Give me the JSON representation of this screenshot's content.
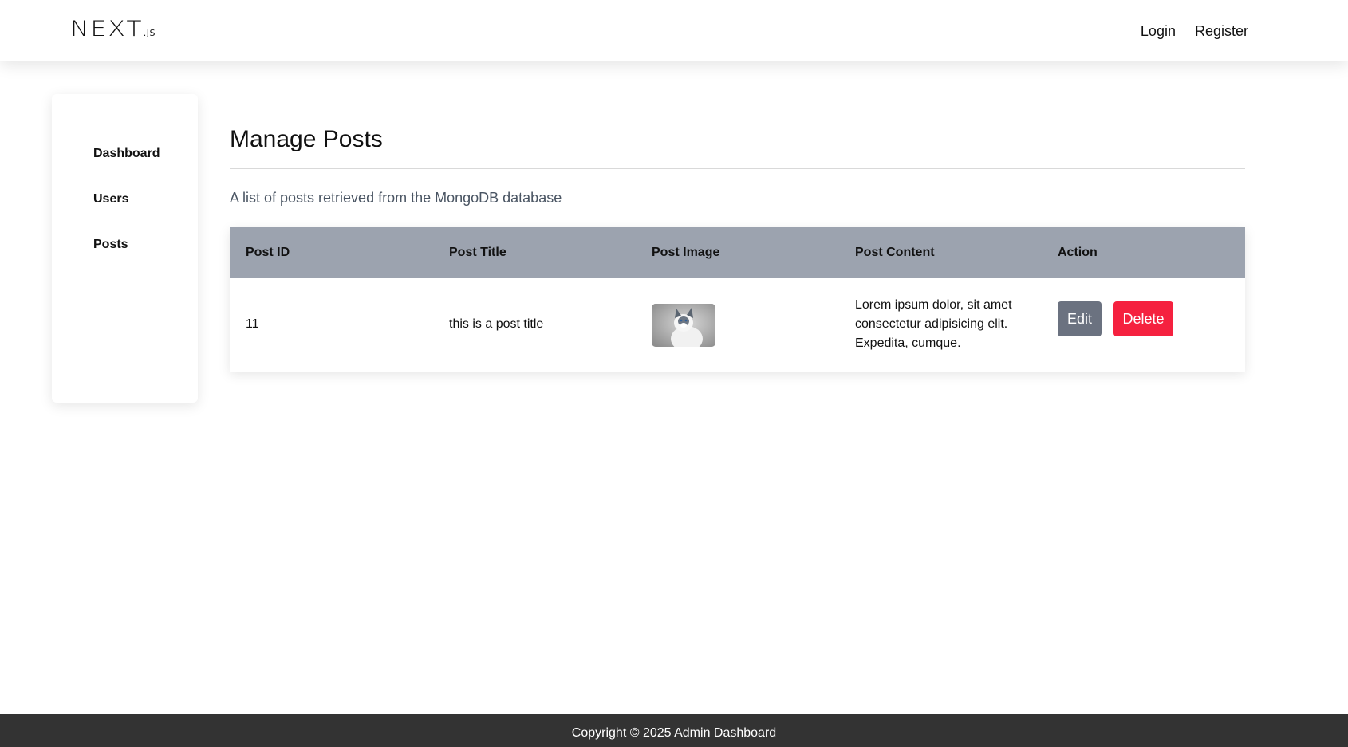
{
  "header": {
    "logo_main": "NEXT",
    "logo_suffix": ".JS",
    "nav": {
      "login": "Login",
      "register": "Register"
    }
  },
  "sidebar": {
    "items": [
      {
        "label": "Dashboard"
      },
      {
        "label": "Users"
      },
      {
        "label": "Posts"
      }
    ]
  },
  "main": {
    "title": "Manage Posts",
    "subtitle": "A list of posts retrieved from the MongoDB database",
    "table": {
      "headers": [
        "Post ID",
        "Post Title",
        "Post Image",
        "Post Content",
        "Action"
      ],
      "rows": [
        {
          "id": "11",
          "title": "this is a post title",
          "image": "cat-photo-thumbnail",
          "content_lines": [
            "Lorem ipsum dolor, sit amet",
            "consectetur adipisicing elit.",
            "Expedita, cumque."
          ],
          "edit_label": "Edit",
          "delete_label": "Delete"
        }
      ]
    }
  },
  "footer": {
    "text": "Copyright © 2025 Admin Dashboard"
  },
  "colors": {
    "table_header": "#9ca3af",
    "edit_button": "#6b7280",
    "delete_button": "#f5213f",
    "footer": "#333333"
  }
}
